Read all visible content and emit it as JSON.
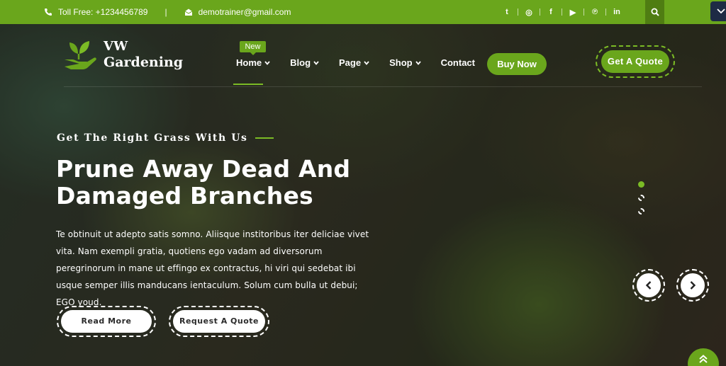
{
  "topbar": {
    "phone": "Toll Free: +1234456789",
    "separator": "|",
    "email": "demotrainer@gmail.com",
    "social": [
      "twitter-icon",
      "instagram-icon",
      "facebook-icon",
      "youtube-icon",
      "pinterest-icon",
      "linkedin-icon"
    ],
    "social_glyphs": [
      "t",
      "◎",
      "f",
      "▶",
      "℗",
      "in"
    ]
  },
  "logo": {
    "line1": "VW",
    "line2": "Gardening"
  },
  "nav": {
    "badge": "New",
    "items": [
      {
        "label": "Home",
        "dropdown": true
      },
      {
        "label": "Blog",
        "dropdown": true
      },
      {
        "label": "Page",
        "dropdown": true
      },
      {
        "label": "Shop",
        "dropdown": true
      },
      {
        "label": "Contact",
        "dropdown": false
      }
    ],
    "buy_now": "Buy Now",
    "get_quote": "Get A Quote"
  },
  "hero": {
    "eyebrow": "Get The Right Grass With Us",
    "headline_line1": "Prune Away Dead And",
    "headline_line2": "Damaged Branches",
    "description": "Te obtinuit ut adepto satis somno. Aliisque institoribus iter deliciae vivet vita. Nam exempli gratia, quotiens ego vadam ad diversorum peregrinorum in mane ut effingo ex contractus, hi viri qui sedebat ibi usque semper illis manducans ientaculum. Solum cum bulla ut debui; EGO youd.",
    "read_more": "Read More",
    "request_quote": "Request A Quote"
  },
  "colors": {
    "brand_green": "#6aa61c",
    "accent_green": "#7bbb25",
    "dark_green": "#4f7d12"
  }
}
